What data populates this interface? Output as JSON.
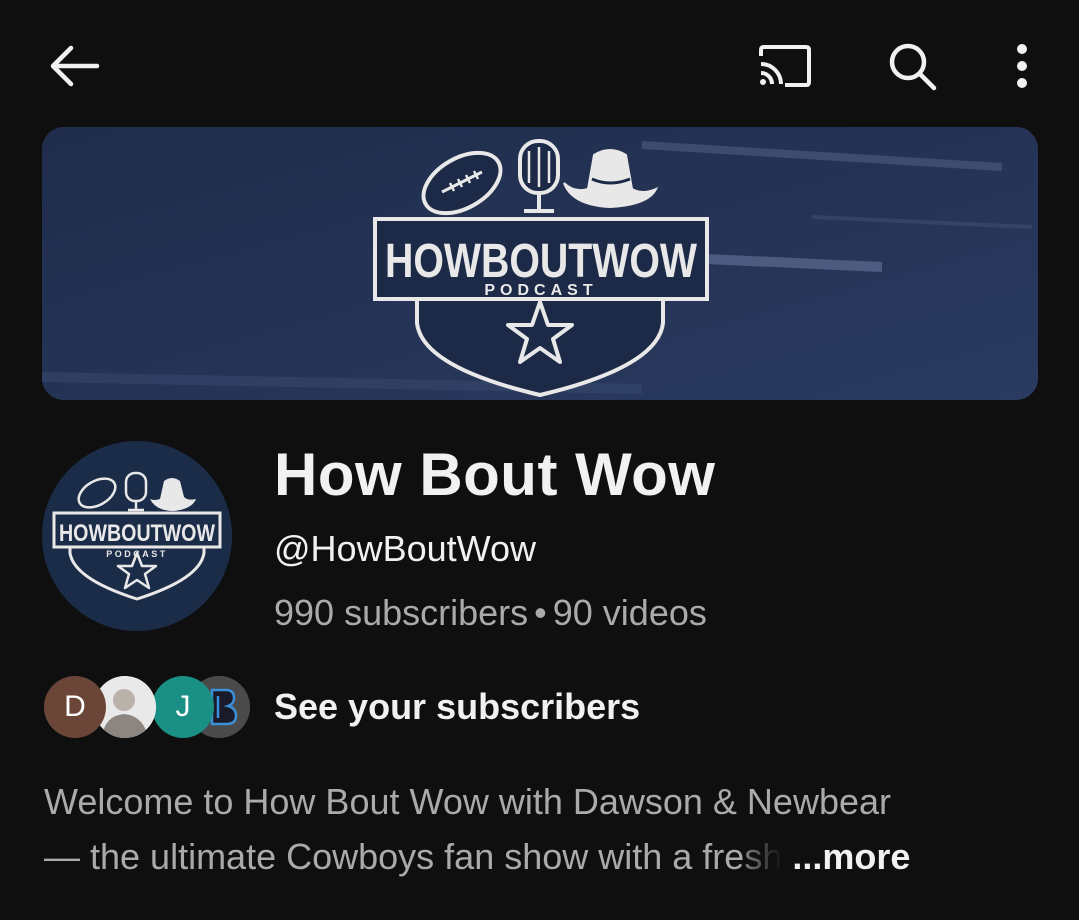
{
  "topbar": {
    "back_icon": "arrow-left-icon",
    "cast_icon": "cast-icon",
    "search_icon": "search-icon",
    "more_icon": "more-vertical-icon"
  },
  "banner": {
    "logo_title": "HOWBOUTWOW",
    "logo_subtitle": "PODCAST",
    "background_color": "#243355"
  },
  "avatar": {
    "logo_title": "HOWBOUTWOW",
    "logo_subtitle": "PODCAST"
  },
  "channel": {
    "name": "How Bout Wow",
    "handle": "@HowBoutWow",
    "subscribers": "990 subscribers",
    "separator": "•",
    "videos": "90 videos"
  },
  "subscribers_row": {
    "avatars": [
      {
        "letter": "D",
        "color": "#6b4638"
      },
      {
        "letter": "",
        "color": "#e9e9e9"
      },
      {
        "letter": "J",
        "color": "#1a8f84"
      },
      {
        "letter": "",
        "color": "#4a4a4a"
      }
    ],
    "label": "See your subscribers"
  },
  "description": {
    "line1": "Welcome to How Bout Wow with Dawson & Newbear",
    "line2": "— the ultimate Cowboys fan show with a fresh",
    "more_label": "...more"
  }
}
